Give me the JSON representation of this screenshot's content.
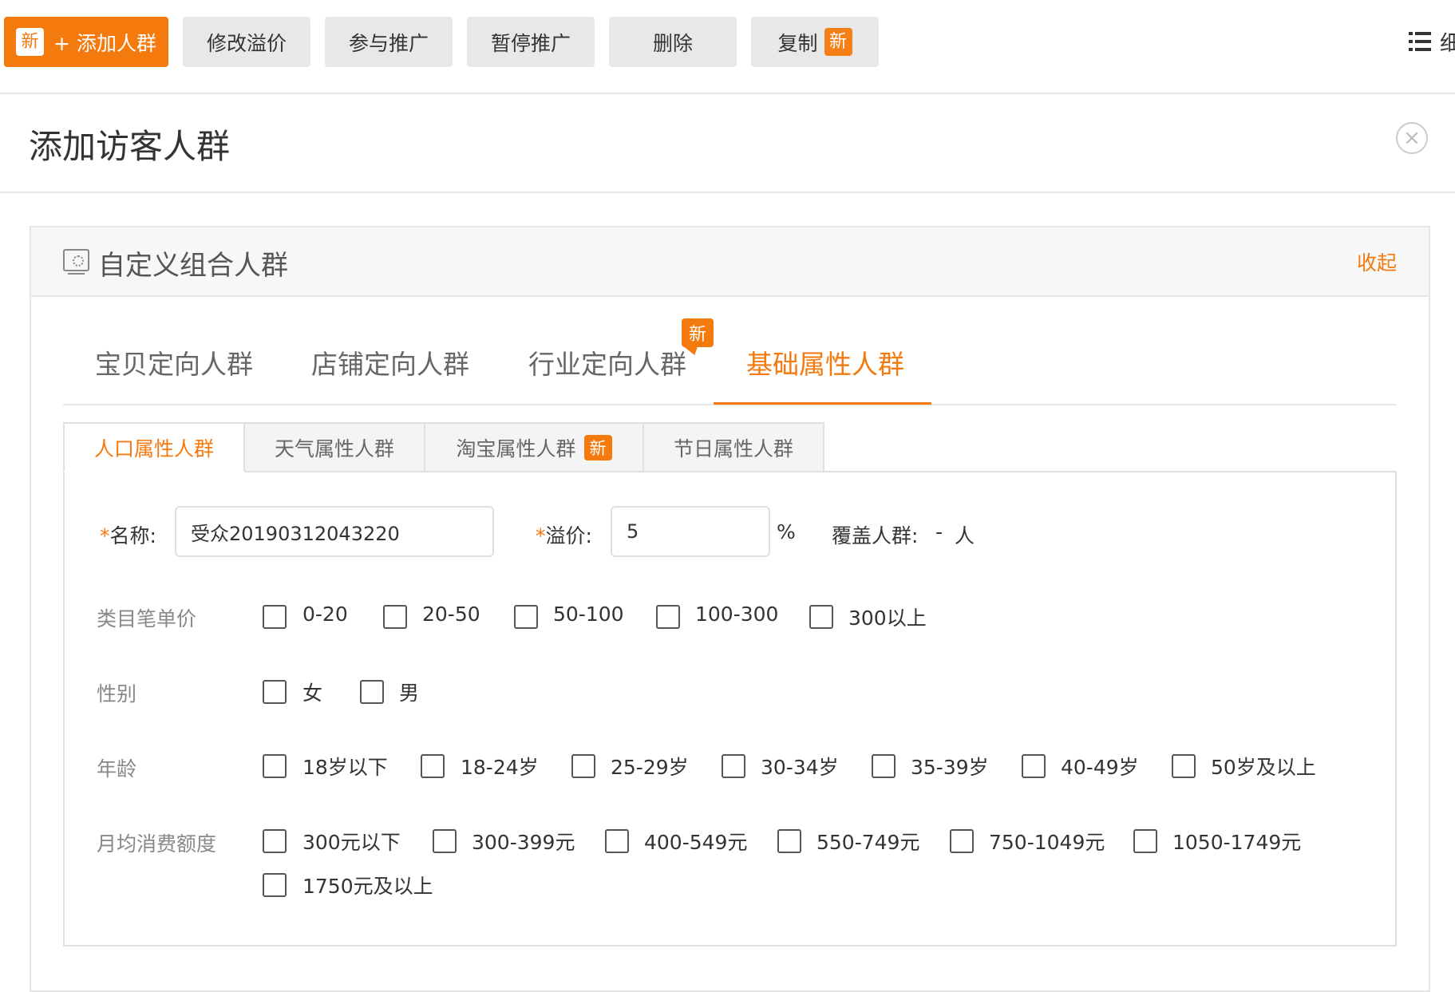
{
  "toolbar": {
    "new_badge": "新",
    "add_label": "+ 添加人群",
    "buttons": [
      "修改溢价",
      "参与推广",
      "暂停推广",
      "删除",
      "复制"
    ],
    "copy_badge": "新",
    "cut_text": "细"
  },
  "dialog": {
    "title": "添加访客人群",
    "close_glyph": "×"
  },
  "panel": {
    "title": "自定义组合人群",
    "collapse_label": "收起"
  },
  "main_tabs": {
    "items": [
      "宝贝定向人群",
      "店铺定向人群",
      "行业定向人群",
      "基础属性人群"
    ],
    "active": "基础属性人群",
    "industry_badge": "新"
  },
  "sub_tabs": {
    "items": [
      "人口属性人群",
      "天气属性人群",
      "淘宝属性人群",
      "节日属性人群"
    ],
    "active": "人口属性人群",
    "taobao_badge": "新"
  },
  "form": {
    "name_label": "名称:",
    "name_value": "受众20190312043220",
    "premium_label": "溢价:",
    "premium_value": "5",
    "premium_unit": "%",
    "coverage_label": "覆盖人群:",
    "coverage_value": "-",
    "coverage_unit": "人",
    "required_mark": "*"
  },
  "filters": {
    "price": {
      "label": "类目笔单价",
      "options": [
        "0-20",
        "20-50",
        "50-100",
        "100-300",
        "300以上"
      ]
    },
    "gender": {
      "label": "性别",
      "options": [
        "女",
        "男"
      ]
    },
    "age": {
      "label": "年龄",
      "options": [
        "18岁以下",
        "18-24岁",
        "25-29岁",
        "30-34岁",
        "35-39岁",
        "40-49岁",
        "50岁及以上"
      ]
    },
    "spend": {
      "label": "月均消费额度",
      "options": [
        "300元以下",
        "300-399元",
        "400-549元",
        "550-749元",
        "750-1049元",
        "1050-1749元",
        "1750元及以上"
      ]
    }
  },
  "colors": {
    "accent": "#f47a0d",
    "button_bg": "#e8e8e8",
    "border": "#e0e0e0"
  }
}
